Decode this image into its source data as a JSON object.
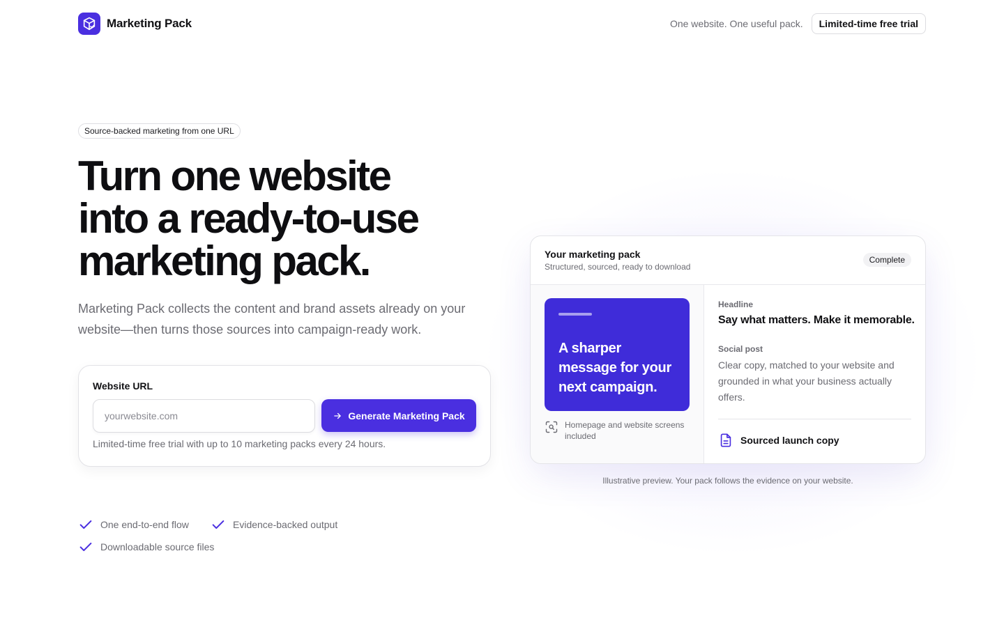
{
  "header": {
    "brand_name": "Marketing Pack",
    "logo_icon": "package-icon",
    "tagline": "One website. One useful pack.",
    "trial_label": "Limited-time free trial"
  },
  "hero": {
    "badge": "Source-backed marketing from one URL",
    "title_lines": [
      "Turn one website",
      "into a ready-to-use",
      "marketing pack."
    ],
    "subtitle": "Marketing Pack collects the content and brand assets already on your website—then turns those sources into campaign-ready work."
  },
  "url_form": {
    "label": "Website URL",
    "placeholder": "yourwebsite.com",
    "value": "",
    "button_label": "Generate Marketing Pack",
    "button_icon": "arrow-right-icon",
    "note": "Limited-time free trial with up to 10 marketing packs every 24 hours."
  },
  "features": [
    {
      "label": "One end-to-end flow",
      "icon": "check-icon"
    },
    {
      "label": "Evidence-backed output",
      "icon": "check-icon"
    },
    {
      "label": "Downloadable source files",
      "icon": "check-icon"
    }
  ],
  "preview": {
    "title": "Your marketing pack",
    "subtitle": "Structured, sourced, ready to download",
    "status": "Complete",
    "tile_text": "A sharper message for your next campaign.",
    "screens_icon": "scan-search-icon",
    "screens_text": "Homepage and website screens included",
    "headline_label": "Headline",
    "headline_value": "Say what matters. Make it memorable.",
    "social_label": "Social post",
    "social_value": "Clear copy, matched to your website and grounded in what your business actually offers.",
    "sourced_icon": "document-icon",
    "sourced_label": "Sourced launch copy",
    "caption": "Illustrative preview. Your pack follows the evidence on your website."
  },
  "colors": {
    "accent": "#4a2fe0",
    "tile": "#3f2cd9",
    "text": "#111114",
    "muted": "#6b6b72"
  }
}
